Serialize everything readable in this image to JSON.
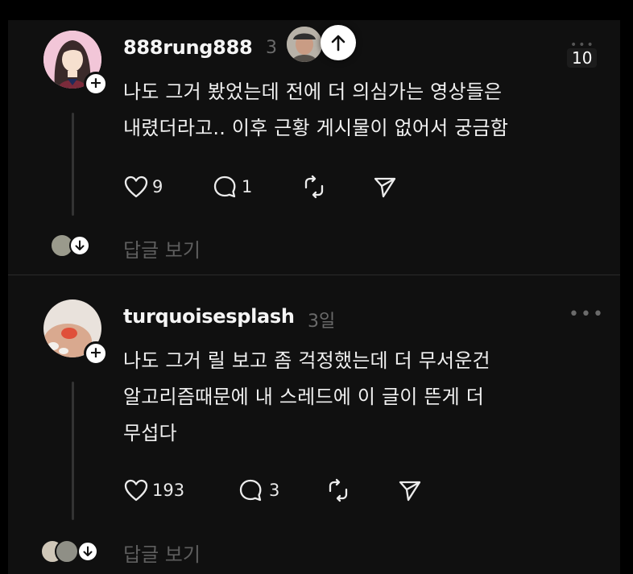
{
  "comments": [
    {
      "username": "888rung888",
      "time_partial": "3",
      "text": "나도 그거 봤었는데 전에 더 의심가는 영상들은\n내렸더라고.. 이후 근황 게시물이 없어서 궁금함",
      "likes": "9",
      "replies": "1",
      "view_replies": "답글 보기",
      "more_count": "10"
    },
    {
      "username": "turquoisesplash",
      "time": "3일",
      "text": "나도 그거 릴 보고 좀 걱정했는데 더 무서운건\n알고리즘때문에 내 스레드에 이 글이 뜬게 더\n무섭다",
      "likes": "193",
      "replies": "3",
      "view_replies": "답글 보기",
      "more": "..."
    }
  ],
  "icons": {
    "like": "heart-icon",
    "comment": "comment-icon",
    "repost": "repost-icon",
    "share": "send-icon",
    "follow": "plus-icon",
    "scroll": "arrow-up-icon",
    "expand": "arrow-down-icon"
  }
}
